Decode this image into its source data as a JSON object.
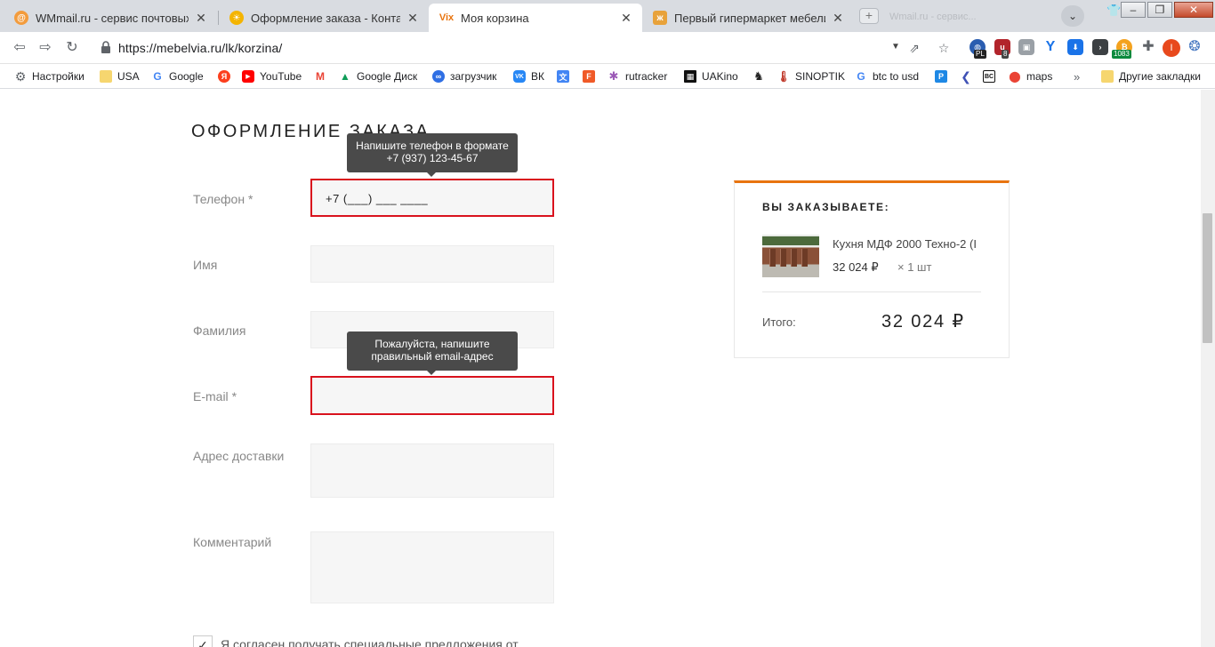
{
  "browser": {
    "tabs": [
      {
        "title": "WMmail.ru - сервис почтовых рассылок",
        "active": false
      },
      {
        "title": "Оформление заказа - Контактная информация",
        "active": false
      },
      {
        "title": "Моя корзина",
        "active": true
      },
      {
        "title": "Первый гипермаркет мебели — онлайн",
        "active": false
      }
    ],
    "ghost_tab_text": "Wmail.ru - сервис...",
    "url": "https://mebelvia.ru/lk/korzina/",
    "extension_badges": {
      "pl": "PL",
      "count8": "8",
      "counter": "1083"
    },
    "avatar_letter": "I",
    "bookmarks": [
      {
        "label": "Настройки",
        "icon": "gear-icon"
      },
      {
        "label": "USA",
        "icon": "folder-icon"
      },
      {
        "label": "Google",
        "icon": "google-icon"
      },
      {
        "label": "",
        "icon": "yandex-icon"
      },
      {
        "label": "YouTube",
        "icon": "youtube-icon"
      },
      {
        "label": "",
        "icon": "gmail-icon"
      },
      {
        "label": "Google Диск",
        "icon": "google-drive-icon"
      },
      {
        "label": "загрузчик",
        "icon": "infinity-icon"
      },
      {
        "label": "ВК",
        "icon": "vk-icon"
      },
      {
        "label": "",
        "icon": "translate-icon"
      },
      {
        "label": "",
        "icon": "f-icon"
      },
      {
        "label": "rutracker",
        "icon": "rutracker-icon"
      },
      {
        "label": "UAKino",
        "icon": "uakino-icon"
      },
      {
        "label": "",
        "icon": "chess-icon"
      },
      {
        "label": "SINOPTIK",
        "icon": "thermometer-icon"
      },
      {
        "label": "btc to usd",
        "icon": "google-icon"
      },
      {
        "label": "",
        "icon": "p-icon"
      },
      {
        "label": "",
        "icon": "arrow-icon"
      },
      {
        "label": "",
        "icon": "bc-icon"
      },
      {
        "label": "maps",
        "icon": "maps-icon"
      }
    ],
    "bookmarks_more": "»",
    "other_bookmarks": "Другие закладки"
  },
  "checkout": {
    "title": "ОФОРМЛЕНИЕ ЗАКАЗА",
    "phone": {
      "label": "Телефон",
      "required_mark": "*",
      "value": "+7 (___) ___ ____",
      "tooltip_line1": "Напишите телефон в формате",
      "tooltip_line2": "+7 (937) 123-45-67"
    },
    "first_name": {
      "label": "Имя",
      "value": ""
    },
    "last_name": {
      "label": "Фамилия",
      "value": ""
    },
    "email": {
      "label": "E-mail",
      "required_mark": "*",
      "value": "",
      "tooltip_line1": "Пожалуйста, напишите",
      "tooltip_line2": "правильный email-адрес"
    },
    "address": {
      "label": "Адрес доставки",
      "value": ""
    },
    "comment": {
      "label": "Комментарий",
      "value": ""
    },
    "consent": {
      "checked": true,
      "check_glyph": "✓",
      "text": "Я согласен получать специальные предложения от"
    }
  },
  "summary": {
    "title": "ВЫ ЗАКАЗЫВАЕТЕ:",
    "item": {
      "name": "Кухня МДФ 2000 Техно-2 (I",
      "price": "32 024 ₽",
      "qty": "× 1 шт"
    },
    "total_label": "Итого:",
    "total_value": "32 024 ₽"
  },
  "colors": {
    "accent": "#e8740f",
    "error": "#d9121d",
    "tooltip_bg": "#4a4a4a"
  }
}
